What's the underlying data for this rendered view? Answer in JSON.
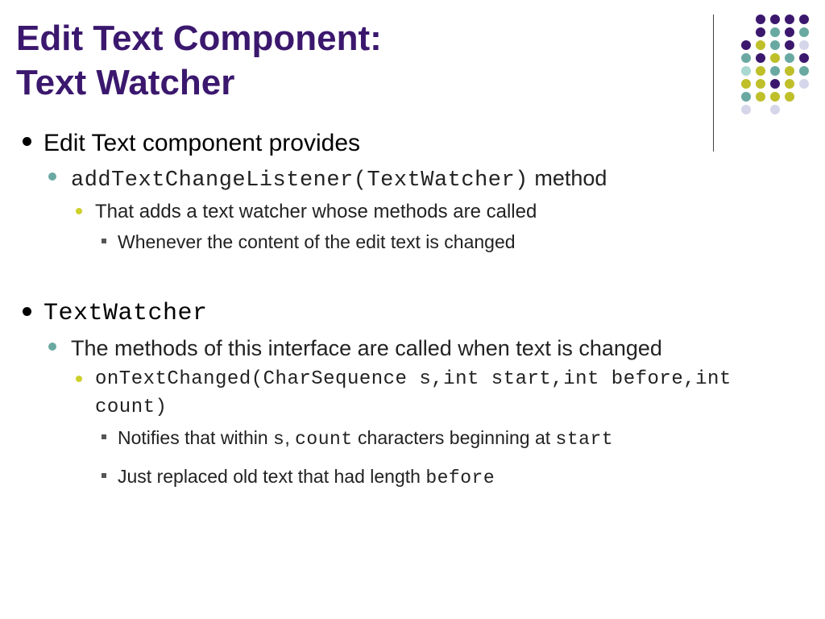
{
  "title_line1": "Edit Text Component:",
  "title_line2": "Text Watcher",
  "item1": {
    "text": "Edit Text component provides",
    "sub1": {
      "code": "addTextChangeListener(TextWatcher)",
      "suffix": " method",
      "subsub": {
        "text": "That adds a text watcher whose methods are called",
        "sub": "Whenever the content of the edit text is changed"
      }
    }
  },
  "item2": {
    "code": "TextWatcher",
    "sub": {
      "text": "The methods of this interface are called when text is changed",
      "subsub": {
        "code": "onTextChanged(CharSequence s,int start,int before,int count)",
        "d1_pre": "Notifies that within ",
        "d1_c1": "s",
        "d1_mid1": ", ",
        "d1_c2": "count",
        "d1_mid2": " characters beginning at ",
        "d1_c3": "start",
        "d2_pre": "Just replaced old text that had length ",
        "d2_c1": "before"
      }
    }
  }
}
